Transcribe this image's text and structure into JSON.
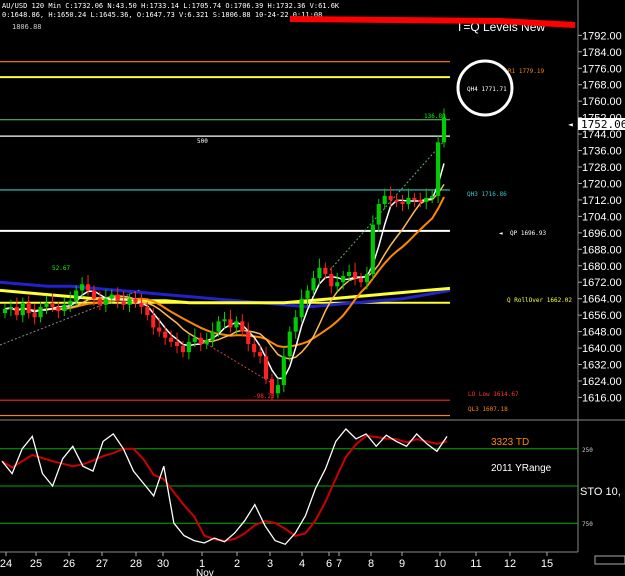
{
  "header": {
    "info_line": "AU/USD 120 Min  C:1732.06 N:43.50 H:1733.14 L:1705.74 O:1706.39 H:1732.36 V:61.6K",
    "info_line2": "0:1648.86, H:1650.24 L:1645.36, O:1647.73 V:6.321  S:1806.88 10-24-22 0:11:08",
    "top_price": "1806.88",
    "chart_title": "T=Q Levels New"
  },
  "annotations": {
    "pivot_r1": "R1 1779.19",
    "qh4": "QH4 1771.71",
    "target_label": "136.80",
    "label_500": "500",
    "qh3": "QH3 1716.86",
    "qp": "QP 1696.93",
    "q_rollover": "Q RollOver 1662.02",
    "lo_low": "LO Low 1614.67",
    "ql3": "QL3 1607.18",
    "left_val": "52.67",
    "dip_val": "-98.23"
  },
  "indicator": {
    "label_td": "3323 TD",
    "label_range": "2011 YRange",
    "label_sto": "STO  10,"
  },
  "x_axis": {
    "labels": [
      "24",
      "25",
      "26",
      "27",
      "28",
      "30",
      "1",
      "2",
      "3",
      "4",
      "6",
      "7",
      "8",
      "9",
      "10",
      "11",
      "12",
      "15"
    ],
    "month_label": "Nov"
  },
  "colors": {
    "background": "#000000",
    "up_candle": "#00cc00",
    "down_candle": "#ff2222",
    "yellow_line": "#ffff33",
    "blue_line": "#2222cc",
    "orange_line": "#ff8800",
    "light_orange": "#ffbb55",
    "white_line": "#ffffff",
    "cyan_line": "#33cccc",
    "red_ma": "#ff3300",
    "stoch_signal": "#cc0000",
    "grid": "#404040"
  },
  "chart_data": {
    "type": "line",
    "title": "T=Q Levels New",
    "ylim": [
      1606,
      1798
    ],
    "y_ticks": [
      1616,
      1624,
      1632,
      1640,
      1648,
      1656,
      1664,
      1672,
      1680,
      1688,
      1696,
      1704,
      1712,
      1720,
      1728,
      1736,
      1744,
      1752,
      1760,
      1768,
      1776,
      1784,
      1792
    ],
    "current_price": 1752.06,
    "levels": [
      {
        "name": "R1",
        "value": 1779.19
      },
      {
        "name": "QH4",
        "value": 1771.71
      },
      {
        "name": "500",
        "value": 1743
      },
      {
        "name": "QH3",
        "value": 1716.86
      },
      {
        "name": "QP",
        "value": 1696.93
      },
      {
        "name": "Q RollOver",
        "value": 1662.02
      },
      {
        "name": "LO Low",
        "value": 1614.67
      },
      {
        "name": "QL3",
        "value": 1607.18
      }
    ],
    "price_series": [
      1659,
      1660,
      1656,
      1662,
      1657,
      1655,
      1660,
      1662,
      1660,
      1658,
      1661,
      1663,
      1668,
      1671,
      1668,
      1664,
      1661,
      1664,
      1666,
      1663,
      1661,
      1664,
      1662,
      1660,
      1656,
      1650,
      1648,
      1645,
      1643,
      1641,
      1638,
      1643,
      1645,
      1642,
      1644,
      1648,
      1653,
      1654,
      1650,
      1653,
      1648,
      1642,
      1638,
      1636,
      1625,
      1618,
      1622,
      1636,
      1648,
      1655,
      1664,
      1668,
      1674,
      1679,
      1676,
      1670,
      1672,
      1675,
      1677,
      1674,
      1672,
      1676,
      1700,
      1710,
      1714,
      1712,
      1711,
      1710,
      1713,
      1712,
      1711,
      1713,
      1714,
      1740,
      1752
    ],
    "series": [
      {
        "name": "",
        "values": [
          1668,
          1667,
          1666,
          1665,
          1664,
          1664,
          1663,
          1663,
          1662,
          1662,
          1662,
          1662,
          1662,
          1663,
          1664,
          1665,
          1666,
          1667,
          1668,
          1669
        ]
      },
      {
        "name": "",
        "values": [
          1672,
          1671,
          1670,
          1670,
          1669,
          1668,
          1667,
          1666,
          1665,
          1664,
          1663,
          1662,
          1661,
          1660,
          1661,
          1662,
          1663,
          1664,
          1666,
          1668
        ]
      }
    ],
    "stochastic": {
      "ylim": [
        0,
        100
      ],
      "ticks": [
        250,
        750
      ],
      "k": [
        70,
        60,
        80,
        90,
        60,
        50,
        72,
        82,
        66,
        62,
        86,
        92,
        80,
        62,
        52,
        42,
        66,
        20,
        10,
        6,
        4,
        8,
        5,
        12,
        22,
        35,
        18,
        6,
        3,
        12,
        26,
        48,
        64,
        86,
        96,
        88,
        92,
        82,
        91,
        86,
        82,
        92,
        84,
        78,
        90
      ]
    }
  }
}
